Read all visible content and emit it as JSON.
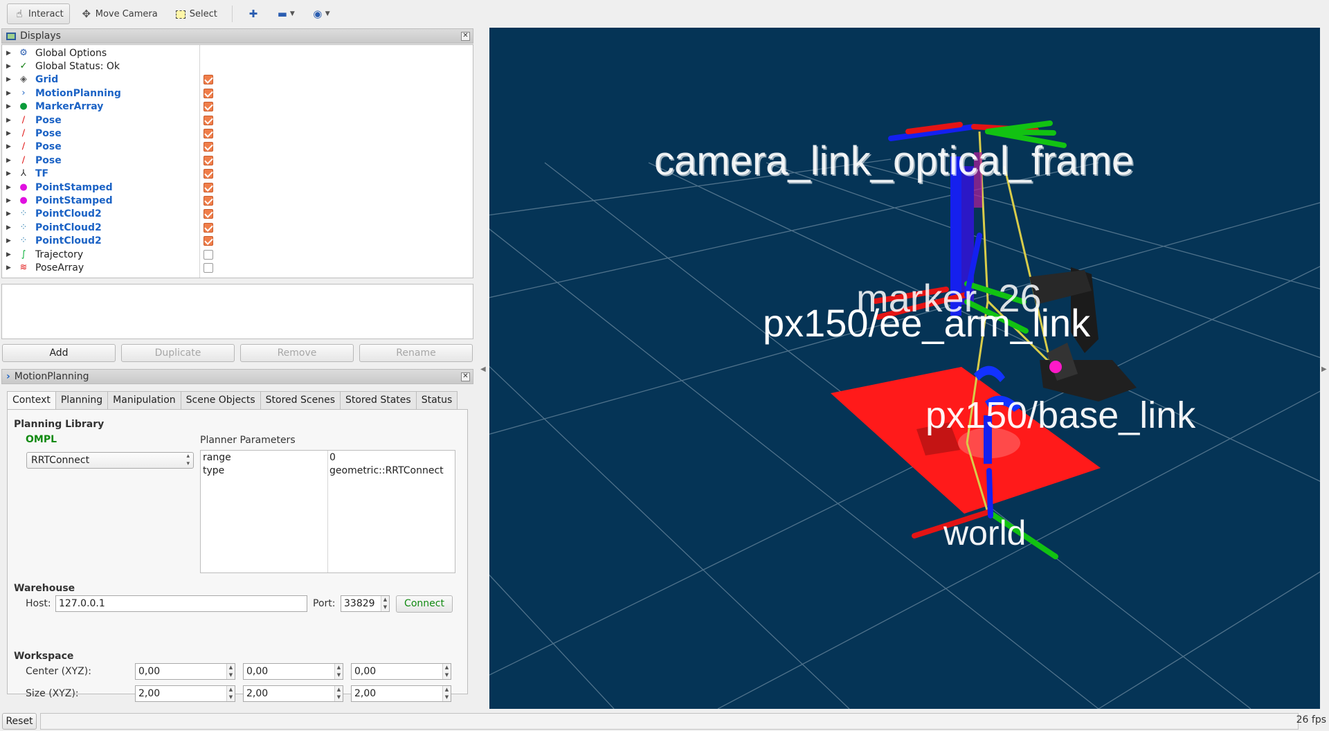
{
  "toolbar": {
    "interact": "Interact",
    "move_camera": "Move Camera",
    "select": "Select"
  },
  "displays_panel": {
    "title": "Displays",
    "items": [
      {
        "label": "Global Options",
        "icon": "gear-icon",
        "style": "plain",
        "checkbox": null
      },
      {
        "label": "Global Status: Ok",
        "icon": "checkmark-icon",
        "style": "plain",
        "checkbox": null
      },
      {
        "label": "Grid",
        "icon": "grid-icon",
        "style": "blue",
        "checkbox": true
      },
      {
        "label": "MotionPlanning",
        "icon": "motion-planning-icon",
        "style": "blue",
        "checkbox": true
      },
      {
        "label": "MarkerArray",
        "icon": "marker-array-icon",
        "style": "blue",
        "checkbox": true
      },
      {
        "label": "Pose",
        "icon": "pose-arrow-icon",
        "style": "blue",
        "checkbox": true
      },
      {
        "label": "Pose",
        "icon": "pose-arrow-icon",
        "style": "blue",
        "checkbox": true
      },
      {
        "label": "Pose",
        "icon": "pose-arrow-icon",
        "style": "blue",
        "checkbox": true
      },
      {
        "label": "Pose",
        "icon": "pose-arrow-icon",
        "style": "blue",
        "checkbox": true
      },
      {
        "label": "TF",
        "icon": "tf-axes-icon",
        "style": "blue",
        "checkbox": true
      },
      {
        "label": "PointStamped",
        "icon": "point-stamped-icon",
        "style": "blue",
        "checkbox": true
      },
      {
        "label": "PointStamped",
        "icon": "point-stamped-icon",
        "style": "blue",
        "checkbox": true
      },
      {
        "label": "PointCloud2",
        "icon": "point-cloud-icon",
        "style": "blue",
        "checkbox": true
      },
      {
        "label": "PointCloud2",
        "icon": "point-cloud-icon",
        "style": "blue",
        "checkbox": true
      },
      {
        "label": "PointCloud2",
        "icon": "point-cloud-icon",
        "style": "blue",
        "checkbox": true
      },
      {
        "label": "Trajectory",
        "icon": "trajectory-icon",
        "style": "plain",
        "checkbox": false
      },
      {
        "label": "PoseArray",
        "icon": "pose-array-icon",
        "style": "plain",
        "checkbox": false
      }
    ],
    "buttons": {
      "add": "Add",
      "duplicate": "Duplicate",
      "remove": "Remove",
      "rename": "Rename"
    }
  },
  "motion_planning": {
    "title": "MotionPlanning",
    "tabs": [
      "Context",
      "Planning",
      "Manipulation",
      "Scene Objects",
      "Stored Scenes",
      "Stored States",
      "Status"
    ],
    "active_tab": "Context",
    "planning_library": {
      "heading": "Planning Library",
      "library": "OMPL",
      "planner": "RRTConnect",
      "params_heading": "Planner Parameters",
      "params": [
        {
          "name": "range",
          "value": "0"
        },
        {
          "name": "type",
          "value": "geometric::RRTConnect"
        }
      ]
    },
    "warehouse": {
      "heading": "Warehouse",
      "host_label": "Host:",
      "host": "127.0.0.1",
      "port_label": "Port:",
      "port": "33829",
      "connect": "Connect"
    },
    "workspace": {
      "heading": "Workspace",
      "center_label": "Center (XYZ):",
      "center": [
        "0,00",
        "0,00",
        "0,00"
      ],
      "size_label": "Size (XYZ):",
      "size": [
        "2,00",
        "2,00",
        "2,00"
      ]
    }
  },
  "viewport": {
    "labels": {
      "camera_frames": "camera_link_optical_frame",
      "marker": "marker_26",
      "ee_link": "px150/ee_arm_link",
      "base_link": "px150/base_link",
      "world": "world"
    },
    "colors": {
      "background": "#053456",
      "grid": "#5d7d95",
      "x_axis": "#e01010",
      "y_axis": "#10c010",
      "z_axis": "#1020e0"
    }
  },
  "statusbar": {
    "reset": "Reset",
    "fps": "26 fps"
  }
}
